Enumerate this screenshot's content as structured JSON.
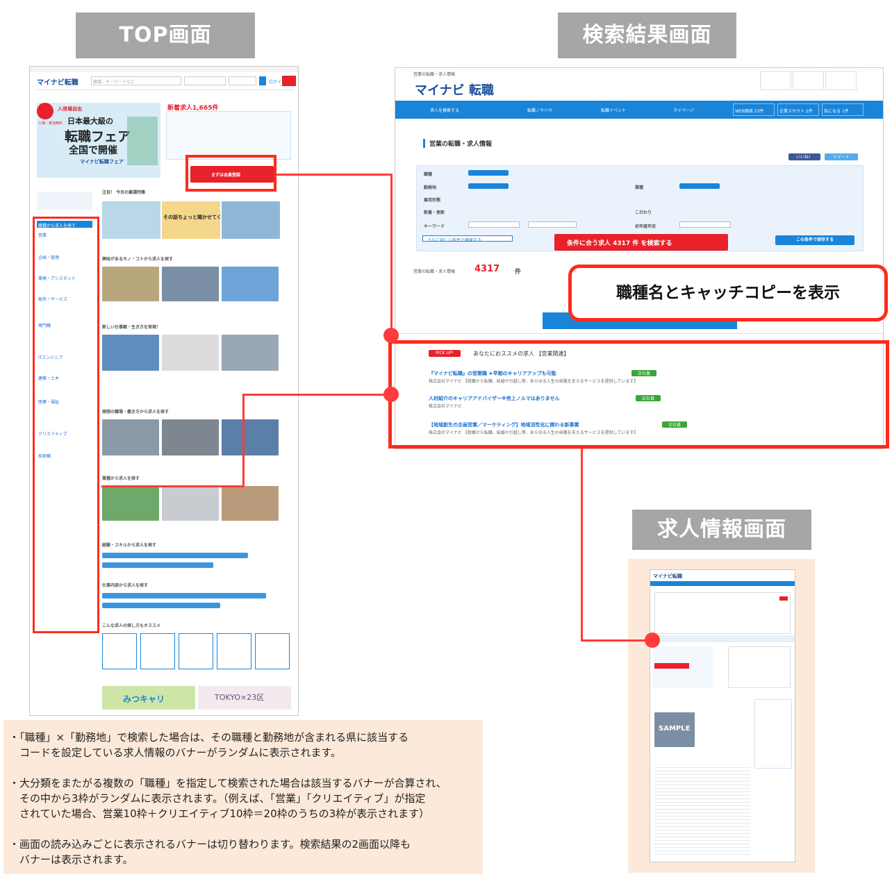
{
  "labels": {
    "top_screen": "TOP画面",
    "search_result_screen": "検索結果画面",
    "job_detail_screen": "求人情報画面"
  },
  "callout": "職種名とキャッチコピーを表示",
  "top": {
    "logo": "マイナビ転職",
    "search_placeholder": "職種、キーワードなど",
    "login": "ログイン",
    "register_btn": "まずは会員登録",
    "new_jobs": "新着求人1,665件",
    "fair_badge_1": "入退場自由",
    "fair_badge_2": "入場・参加無料",
    "fair_title_1": "日本最大級の",
    "fair_title_2": "転職フェア",
    "fair_title_3": "全国で開催",
    "fair_brand": "マイナビ転職フェア",
    "feature_heading": "注目！ 今月の厳選特集",
    "feature_promo": "その話ちょっと聞かせてください！",
    "section_things": "興味があるモノ・コトから求人を探す",
    "section_work": "新しい仕事観・生き方を実現！",
    "section_ideal": "理想の職場・働き方から求人を探す",
    "section_industry": "業種から求人を探す",
    "section_skill": "経験・スキルから求人を探す",
    "section_content": "仕事内容から求人を探す",
    "section_howto": "こんな求人の探し方もオススメ",
    "sidebar_title": "職種から求人を探す",
    "sidebar_items": [
      "営業",
      "企画・管理",
      "事務・アシスタント",
      "販売・サービス",
      "専門職",
      "ITエンジニア",
      "建築・土木",
      "医療・福祉",
      "クリエイティブ",
      "技術職"
    ],
    "banner_1": "みつキャリ",
    "banner_2": "TOKYO×23区"
  },
  "search": {
    "breadcrumb": "営業の転職・求人情報",
    "logo": "マイナビ 転職",
    "nav": [
      "求人を検索する",
      "転職ノウハウ",
      "転職イベント",
      "マイページ"
    ],
    "nav_counts": [
      "WEB面接 23件",
      "企業スカウト 2件",
      "気になる 1件"
    ],
    "page_title": "営業の転職・求人情報",
    "share": [
      "いいね！",
      "ツイート"
    ],
    "filter_rows": [
      "職種",
      "勤務地",
      "雇用形態",
      "新着・更新",
      "キーワード"
    ],
    "filter_right": [
      "業種",
      "こだわり",
      "初年度年収"
    ],
    "search_btn": "条件に合う求人 4317 件 を検索する",
    "save_btn": "この条件で保存する",
    "more_cond": "さらに詳しい条件で検索する",
    "result_label": "営業の転職・求人情報",
    "result_count": "4317",
    "result_unit": "件",
    "pickup_badge": "PICK UP!",
    "pickup_heading": "あなたにおススメの求人 【営業関連】",
    "pickups": [
      {
        "title": "『マイナビ転職』の営業職 ★早期のキャリアアップも可能",
        "tag": "正社員",
        "company": "株式会社マイナビ 【就職から転職、結婚や引越し等、あらゆる人生の岐路を支えるサービスを提供しています】"
      },
      {
        "title": "人材紹介のキャリアアドバイザー※売上ノルマはありません",
        "tag": "正社員",
        "company": "株式会社マイナビ"
      },
      {
        "title": "【地域創生の企画営業／マーケティング】地域活性化に関わる新事業",
        "tag": "正社員",
        "company": "株式会社マイナビ 【就職から転職、結婚や引越し等、あらゆる人生の岐路を支えるサービスを提供しています】"
      }
    ]
  },
  "detail": {
    "logo": "マイナビ転職",
    "sample": "SAMPLE"
  },
  "notes": [
    "・「職種」×「勤務地」で検索した場合は、その職種と勤務地が含まれる県に該当する\n　コードを設定している求人情報のバナーがランダムに表示されます。",
    "・大分類をまたがる複数の「職種」を指定して検索された場合は該当するバナーが合算され、\n　その中から3枠がランダムに表示されます。（例えば、「営業」「クリエイティブ」が指定\n　されていた場合、営業10枠＋クリエイティブ10枠＝20枠のうちの3枠が表示されます）",
    "・画面の読み込みごとに表示されるバナーは切り替わります。検索結果の2画面以降も\n　バナーは表示されます。"
  ],
  "colors": {
    "accent_red": "#ff2b1c",
    "brand_blue": "#1a84d8",
    "label_gray": "#a6a6a6",
    "note_bg": "#fce9d9"
  }
}
